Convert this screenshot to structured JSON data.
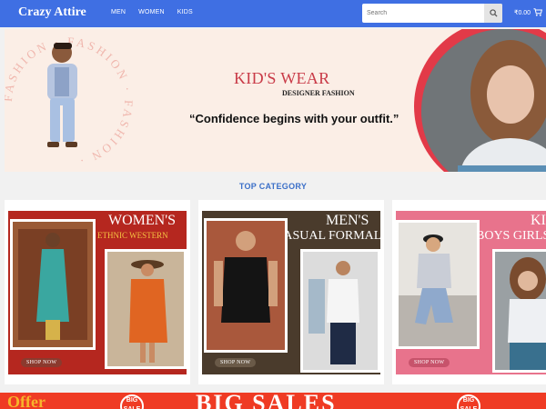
{
  "header": {
    "logo": "Crazy Attire",
    "nav": [
      "MEN",
      "WOMEN",
      "KIDS"
    ],
    "search_placeholder": "Search",
    "cart_total": "₹0.00"
  },
  "hero": {
    "ring_text": "FASHION · FASHION · FASHION ·",
    "title": "KID'S WEAR",
    "subtitle": "DESIGNER FASHION",
    "quote": "“Confidence begins with your outfit.”"
  },
  "section_title": "TOP CATEGORY",
  "categories": [
    {
      "title": "WOMEN'S",
      "subtitle": "ETHNIC WESTERN",
      "cta": "SHOP NOW"
    },
    {
      "title": "MEN'S",
      "subtitle": "CASUAL FORMAL",
      "cta": "SHOP NOW"
    },
    {
      "title": "KIDS",
      "subtitle": "BOYS GIRLS",
      "cta": "SHOP NOW"
    }
  ],
  "sale_banner": {
    "offer": "Offer",
    "headline": "BIG SALES",
    "badge": "BIG SALE"
  },
  "colors": {
    "header_bg": "#3f6fe3",
    "hero_bg": "#fbeee6",
    "accent_red": "#e23a48",
    "women_bg": "#b5271f",
    "men_bg": "#4a3b2c",
    "kids_bg": "#e8738c"
  }
}
